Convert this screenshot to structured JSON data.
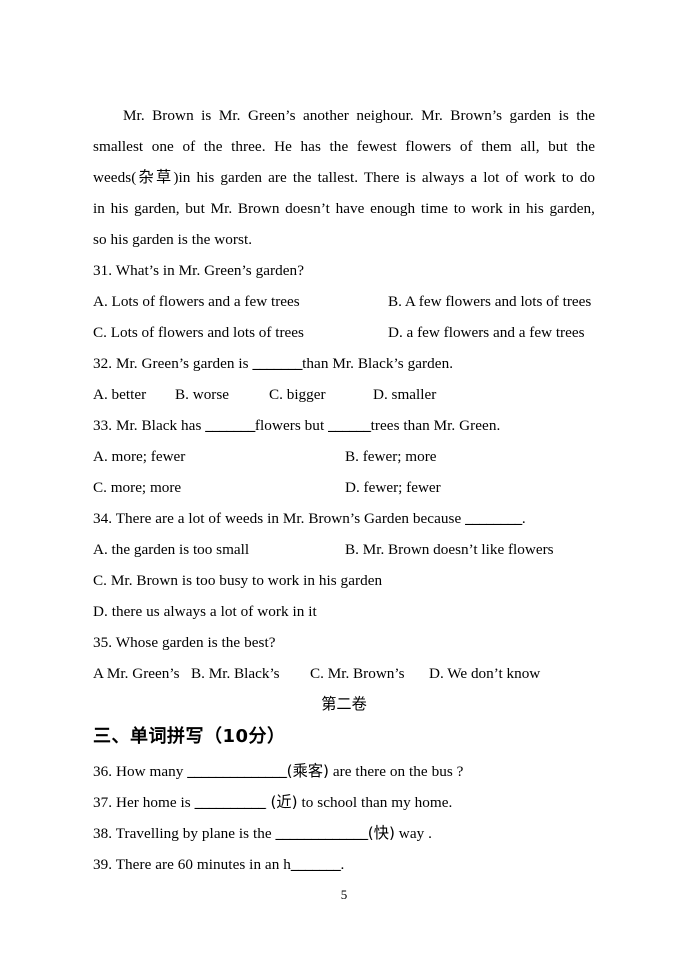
{
  "document": {
    "page_number": "5",
    "passage": {
      "lines": [
        "Mr. Brown is Mr. Green’s another neighour. Mr. Brown’s garden is the",
        "smallest one of the three. He has the fewest flowers of them all, but the",
        "weeds(杂草)in his garden are the tallest. There is always a lot of work to do",
        "in his garden, but Mr. Brown doesn’t have enough time to work in his garden,",
        "so his garden is the worst."
      ]
    },
    "questions": [
      {
        "number": "31.",
        "stem": "31. What’s in Mr. Green’s garden?",
        "options_rows": [
          {
            "left": "A. Lots of flowers and a few trees",
            "right": "B. A few flowers and lots of trees"
          },
          {
            "left": "C. Lots of flowers and lots of trees",
            "right": "D. a few flowers and a few trees"
          }
        ]
      },
      {
        "number": "32.",
        "stem_before": "32. Mr. Green’s garden is ",
        "stem_after": "than Mr. Black’s garden.",
        "options_inline": [
          "A. better",
          "B. worse",
          "C. bigger",
          "D. smaller"
        ]
      },
      {
        "number": "33.",
        "stem_before": "33. Mr. Black has ",
        "stem_middle": "flowers but ",
        "stem_after": "trees than Mr. Green.",
        "options_rows": [
          {
            "left": "A. more; fewer",
            "right": "B. fewer; more"
          },
          {
            "left": "C. more; more",
            "right": "D. fewer; fewer"
          }
        ]
      },
      {
        "number": "34.",
        "stem_before": "34. There are a lot of weeds in Mr. Brown’s Garden because ",
        "stem_after": ".",
        "options_rows": [
          {
            "left": "A. the garden is too small",
            "right": "B. Mr. Brown doesn’t like flowers"
          }
        ],
        "options_full": [
          "C. Mr. Brown is too busy to work in his garden",
          "D. there us always a lot of work in it"
        ]
      },
      {
        "number": "35.",
        "stem": "35. Whose garden is the best?",
        "options_inline": [
          "A Mr. Green’s",
          "B. Mr. Black’s",
          "C. Mr. Brown’s",
          "D. We don’t know"
        ]
      }
    ],
    "part_two_heading": "第二卷",
    "section_heading": "三、单词拼写（10分）",
    "fill_in_questions": [
      {
        "number": "36.",
        "before": "36. How many ",
        "hint": "(乘客)",
        "after": " are there on the bus ?"
      },
      {
        "number": "37.",
        "before": "37. Her home is ",
        "hint": " (近)",
        "after": " to school than my home."
      },
      {
        "number": "38.",
        "before": "38. Travelling  by plane is the ",
        "hint": "(快)",
        "after": " way ."
      },
      {
        "number": "39.",
        "before": "39. There are 60 minutes in an h",
        "hint": "",
        "after": "."
      }
    ]
  }
}
